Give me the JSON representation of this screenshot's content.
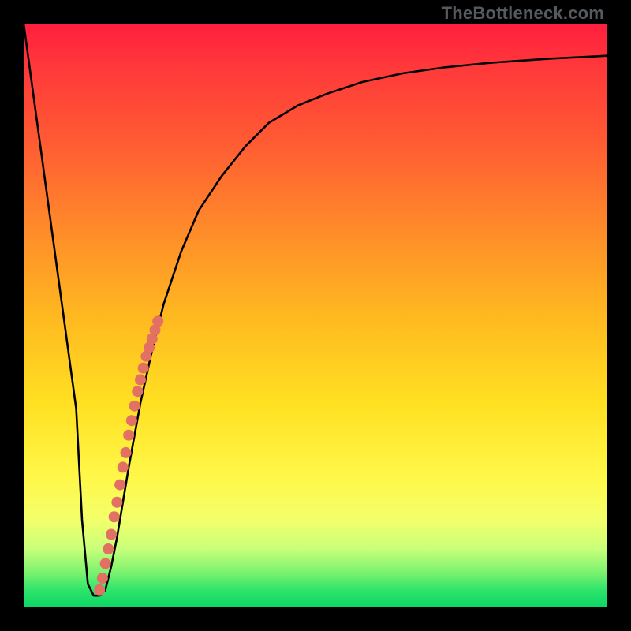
{
  "watermark": "TheBottleneck.com",
  "colors": {
    "curve_stroke": "#000000",
    "marker_fill": "#e27063",
    "background_frame": "#000000"
  },
  "chart_data": {
    "type": "line",
    "title": "",
    "xlabel": "",
    "ylabel": "",
    "xlim": [
      0,
      100
    ],
    "ylim": [
      0,
      100
    ],
    "grid": false,
    "legend": false,
    "series": [
      {
        "name": "bottleneck-curve",
        "x": [
          0,
          3,
          6,
          9,
          10,
          11,
          12,
          13,
          14,
          15,
          16,
          18,
          20,
          22,
          24,
          27,
          30,
          34,
          38,
          42,
          47,
          52,
          58,
          65,
          72,
          80,
          90,
          100
        ],
        "y": [
          100,
          78,
          56,
          34,
          15,
          4,
          2,
          2,
          3,
          7,
          12,
          24,
          35,
          44,
          52,
          61,
          68,
          74,
          79,
          83,
          86,
          88,
          90,
          91.5,
          92.5,
          93.3,
          94,
          94.5
        ]
      }
    ],
    "markers": {
      "name": "highlight-points",
      "x": [
        13.0,
        13.5,
        14.0,
        14.5,
        15.0,
        15.5,
        16.0,
        16.5,
        17.0,
        17.5,
        18.0,
        18.5,
        19.0,
        19.5,
        20.0,
        20.5,
        21.0,
        21.5,
        22.0,
        22.5,
        23.0
      ],
      "y": [
        3.0,
        5.0,
        7.5,
        10.0,
        12.5,
        15.5,
        18.0,
        21.0,
        24.0,
        26.5,
        29.5,
        32.0,
        34.5,
        37.0,
        39.0,
        41.0,
        43.0,
        44.5,
        46.0,
        47.5,
        49.0
      ]
    }
  }
}
